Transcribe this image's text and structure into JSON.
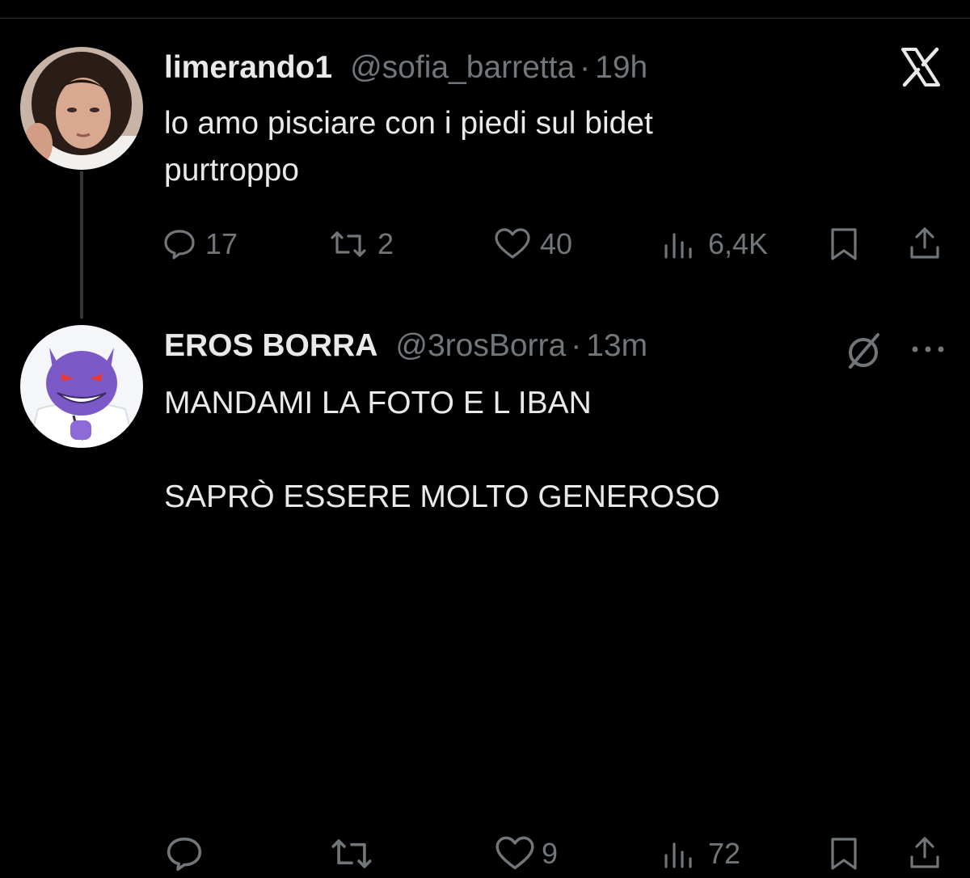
{
  "tweets": [
    {
      "display_name": "limerando1",
      "handle": "@sofia_barretta",
      "separator": "·",
      "time": "19h",
      "text": "lo amo pisciare con i piedi sul bidet\npurtroppo",
      "replies": "17",
      "retweets": "2",
      "likes": "40",
      "views": "6,4K"
    },
    {
      "display_name": "EROS BORRA",
      "handle": "@3rosBorra",
      "separator": "·",
      "time": "13m",
      "text": "MANDAMI LA FOTO E L IBAN\n\nSAPRÒ ESSERE MOLTO GENEROSO",
      "replies": "",
      "retweets": "",
      "likes": "9",
      "views": "72"
    }
  ],
  "icons": {
    "top_right_logo": "x-logo-icon",
    "reply": "comment-bubble-icon",
    "retweet": "retweet-icon",
    "like": "heart-icon",
    "views": "views-bar-chart-icon",
    "bookmark": "bookmark-icon",
    "share": "share-icon",
    "mute": "muted-circle-slash-icon",
    "more": "more-dots-icon"
  },
  "colors": {
    "background": "#000000",
    "text_primary": "#e7e9ea",
    "text_secondary": "#71767b",
    "gengar_purple": "#7b5ac8"
  }
}
